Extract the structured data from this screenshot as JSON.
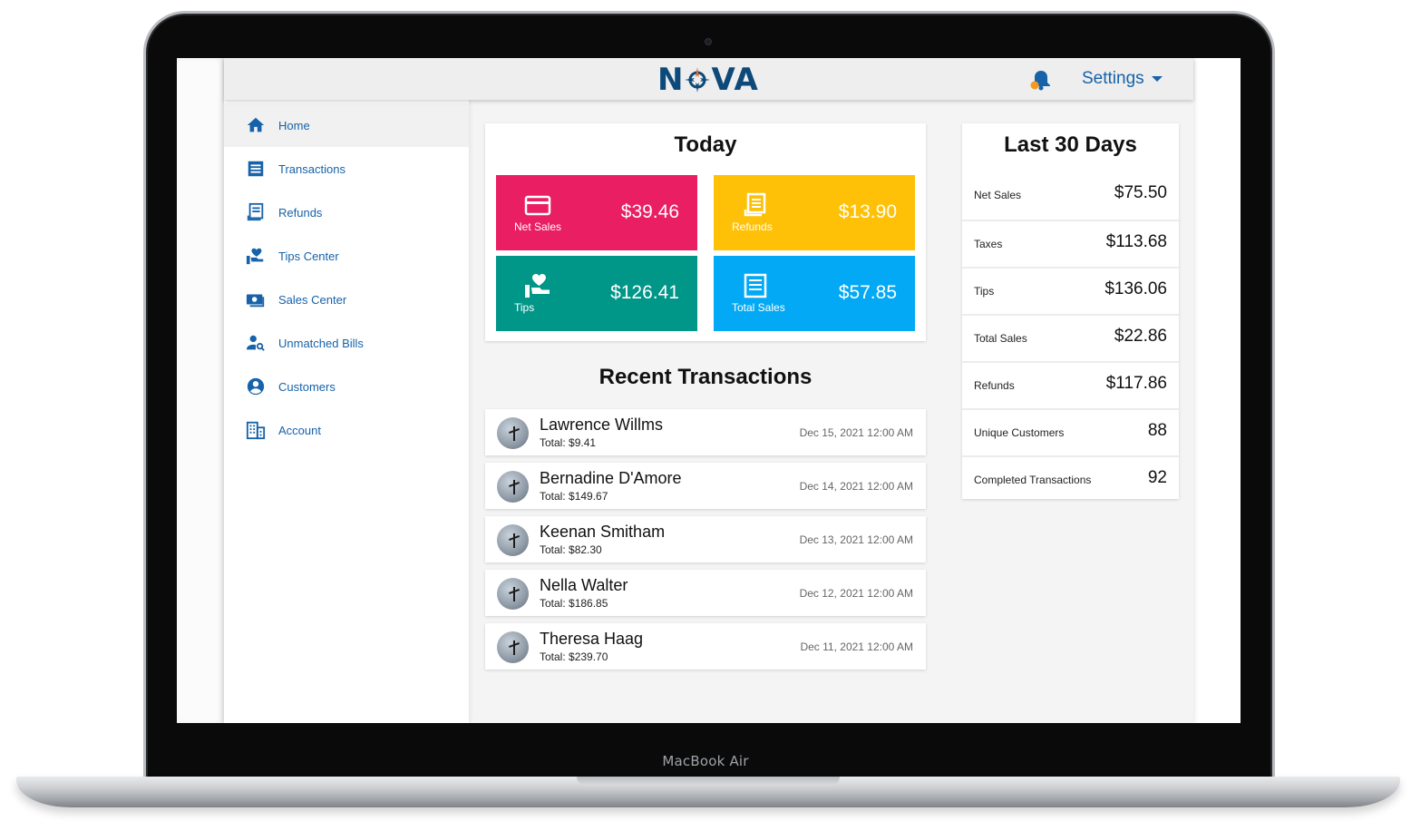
{
  "bezel_label": "MacBook Air",
  "header": {
    "logo_left": "N",
    "logo_right": "VA",
    "settings_label": "Settings"
  },
  "sidebar": {
    "items": [
      {
        "label": "Home",
        "icon": "home-icon"
      },
      {
        "label": "Transactions",
        "icon": "list-icon"
      },
      {
        "label": "Refunds",
        "icon": "receipt-icon"
      },
      {
        "label": "Tips Center",
        "icon": "hand-heart-icon"
      },
      {
        "label": "Sales Center",
        "icon": "cash-icon"
      },
      {
        "label": "Unmatched Bills",
        "icon": "person-search-icon"
      },
      {
        "label": "Customers",
        "icon": "account-circle-icon"
      },
      {
        "label": "Account",
        "icon": "building-icon"
      }
    ]
  },
  "today": {
    "title": "Today",
    "tiles": [
      {
        "label": "Net Sales",
        "value": "$39.46",
        "color": "#e91e63",
        "icon": "credit-card-icon"
      },
      {
        "label": "Refunds",
        "value": "$13.90",
        "color": "#ffc107",
        "icon": "receipt-icon"
      },
      {
        "label": "Tips",
        "value": "$126.41",
        "color": "#009688",
        "icon": "hand-heart-icon"
      },
      {
        "label": "Total Sales",
        "value": "$57.85",
        "color": "#03a9f4",
        "icon": "receipt-icon"
      }
    ]
  },
  "recent": {
    "title": "Recent Transactions",
    "rows": [
      {
        "name": "Lawrence Willms",
        "total": "Total: $9.41",
        "date": "Dec 15, 2021 12:00 AM"
      },
      {
        "name": "Bernadine D'Amore",
        "total": "Total: $149.67",
        "date": "Dec 14, 2021 12:00 AM"
      },
      {
        "name": "Keenan Smitham",
        "total": "Total: $82.30",
        "date": "Dec 13, 2021 12:00 AM"
      },
      {
        "name": "Nella Walter",
        "total": "Total: $186.85",
        "date": "Dec 12, 2021 12:00 AM"
      },
      {
        "name": "Theresa Haag",
        "total": "Total: $239.70",
        "date": "Dec 11, 2021 12:00 AM"
      }
    ]
  },
  "last30": {
    "title": "Last 30 Days",
    "rows": [
      {
        "label": "Net Sales",
        "value": "$75.50"
      },
      {
        "label": "Taxes",
        "value": "$113.68"
      },
      {
        "label": "Tips",
        "value": "$136.06"
      },
      {
        "label": "Total Sales",
        "value": "$22.86"
      },
      {
        "label": "Refunds",
        "value": "$117.86"
      },
      {
        "label": "Unique Customers",
        "value": "88"
      },
      {
        "label": "Completed Transactions",
        "value": "92"
      }
    ]
  }
}
